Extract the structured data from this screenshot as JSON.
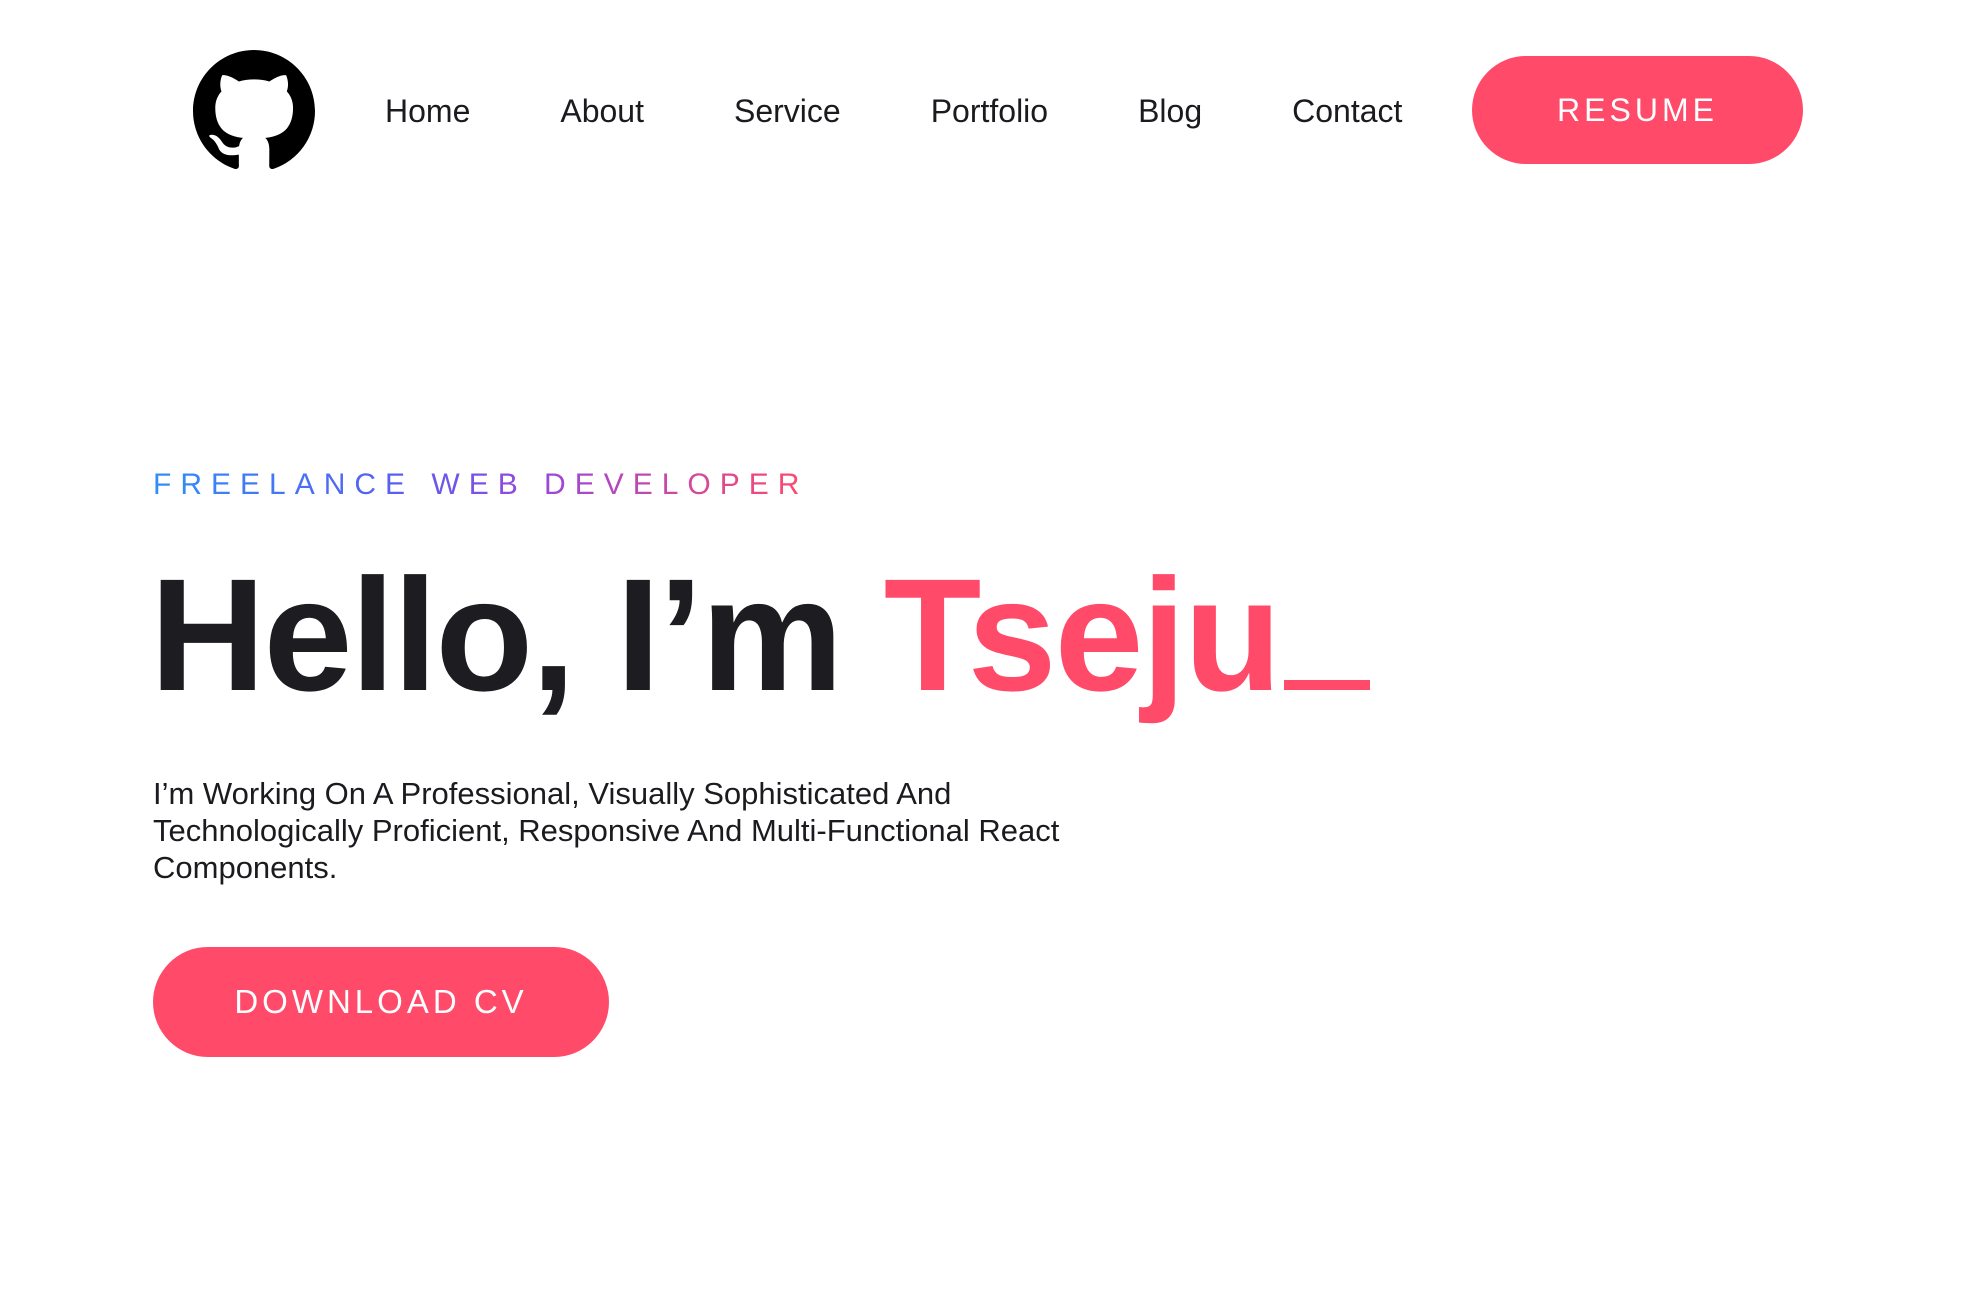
{
  "header": {
    "logo_icon": "github-icon",
    "nav_items": [
      "Home",
      "About",
      "Service",
      "Portfolio",
      "Blog",
      "Contact"
    ],
    "resume_label": "RESUME"
  },
  "hero": {
    "subtitle": "FREELANCE WEB DEVELOPER",
    "greeting": "Hello, I’m ",
    "name": "Tseju",
    "description": "I’m Working On A Professional, Visually Sophisticated And Technologically Proficient, Responsive And Multi-Functional React Components.",
    "download_label": "DOWNLOAD CV"
  },
  "colors": {
    "accent": "#ff4a6a",
    "text": "#1c1c21",
    "gradient_start": "#2f8ff7",
    "gradient_mid": "#9b47d9",
    "gradient_end": "#ff4a6a"
  }
}
